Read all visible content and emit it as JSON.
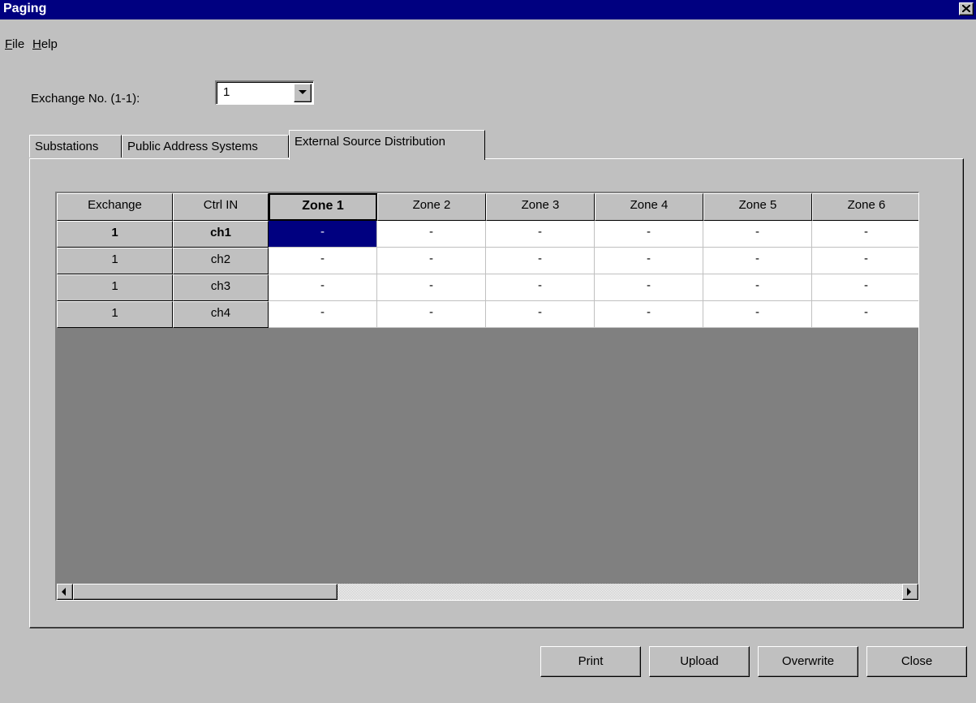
{
  "window": {
    "title": "Paging"
  },
  "menu": [
    {
      "accel": "F",
      "rest": "ile"
    },
    {
      "accel": "H",
      "rest": "elp"
    }
  ],
  "exchange": {
    "label": "Exchange No. (1-1):",
    "value": "1"
  },
  "tabs": [
    "Substations",
    "Public Address Systems",
    "External Source Distribution"
  ],
  "active_tab": 2,
  "table": {
    "columns": [
      "Exchange",
      "Ctrl IN",
      "Zone 1",
      "Zone 2",
      "Zone 3",
      "Zone 4",
      "Zone 5",
      "Zone 6"
    ],
    "rows": [
      [
        "1",
        "ch1",
        "-",
        "-",
        "-",
        "-",
        "-",
        "-"
      ],
      [
        "1",
        "ch2",
        "-",
        "-",
        "-",
        "-",
        "-",
        "-"
      ],
      [
        "1",
        "ch3",
        "-",
        "-",
        "-",
        "-",
        "-",
        "-"
      ],
      [
        "1",
        "ch4",
        "-",
        "-",
        "-",
        "-",
        "-",
        "-"
      ]
    ],
    "selected_row": 0,
    "selected_col": 2
  },
  "buttons": {
    "print": "Print",
    "upload": "Upload",
    "overwrite": "Overwrite",
    "close": "Close"
  }
}
